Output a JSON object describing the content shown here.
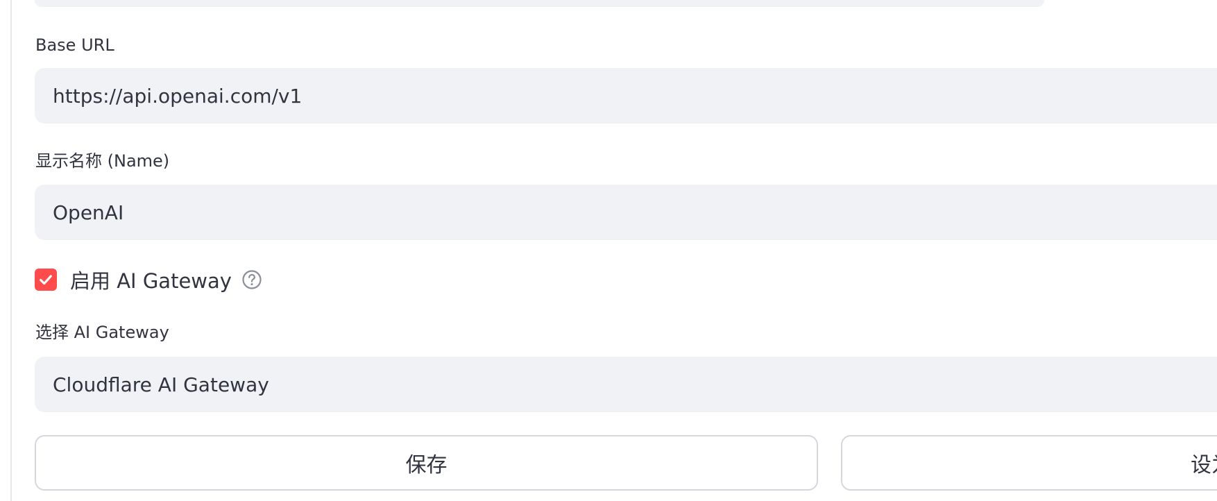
{
  "form": {
    "base_url": {
      "label": "Base URL",
      "value": "https://api.openai.com/v1"
    },
    "display_name": {
      "label": "显示名称 (Name)",
      "value": "OpenAI"
    },
    "enable_gateway": {
      "label": "启用 AI Gateway",
      "checked": true,
      "help_icon": "question-circle-icon"
    },
    "select_gateway": {
      "label": "选择 AI Gateway",
      "value": "Cloudflare AI Gateway"
    }
  },
  "buttons": {
    "save_label": "保存",
    "second_label": "设为"
  },
  "colors": {
    "accent": "#ff4b4b",
    "field_bg": "#f0f2f6",
    "text": "#31333f",
    "border": "#d5d7dd"
  }
}
